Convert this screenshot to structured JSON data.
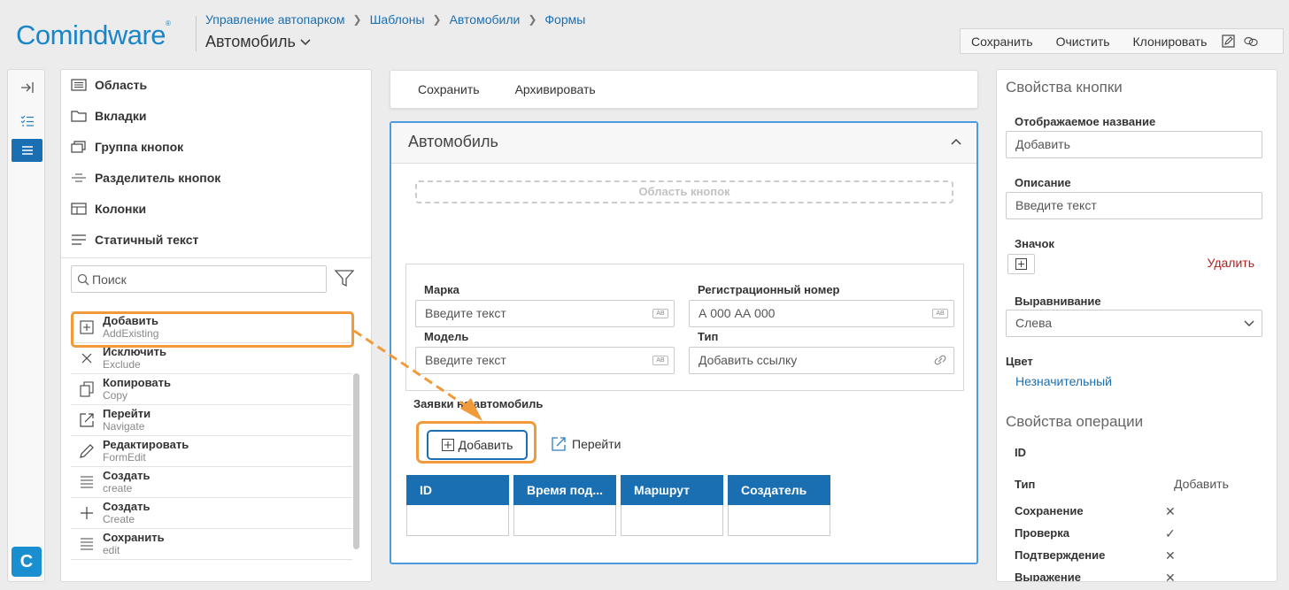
{
  "header": {
    "logo": "Comindware",
    "logo_mark": "®",
    "breadcrumbs": [
      "Управление автопарком",
      "Шаблоны",
      "Автомобили",
      "Формы"
    ],
    "page_title": "Автомобиль",
    "toolbar": {
      "save": "Сохранить",
      "clear": "Очистить",
      "clone": "Клонировать"
    }
  },
  "rail": {
    "brand_letter": "C"
  },
  "left_panel": {
    "sections": [
      "Область",
      "Вкладки",
      "Группа кнопок",
      "Разделитель кнопок",
      "Колонки",
      "Статичный текст"
    ],
    "search_placeholder": "Поиск",
    "operations": [
      {
        "name": "Добавить",
        "code": "AddExisting",
        "icon": "plus-square-icon"
      },
      {
        "name": "Исключить",
        "code": "Exclude",
        "icon": "close-icon"
      },
      {
        "name": "Копировать",
        "code": "Copy",
        "icon": "copy-icon"
      },
      {
        "name": "Перейти",
        "code": "Navigate",
        "icon": "external-link-icon"
      },
      {
        "name": "Редактировать",
        "code": "FormEdit",
        "icon": "pencil-icon"
      },
      {
        "name": "Создать",
        "code": "create",
        "icon": "list-icon"
      },
      {
        "name": "Создать",
        "code": "Create",
        "icon": "plus-icon"
      },
      {
        "name": "Сохранить",
        "code": "edit",
        "icon": "list-icon"
      }
    ]
  },
  "form": {
    "actions": [
      "Сохранить",
      "Архивировать"
    ],
    "title": "Автомобиль",
    "button_area": "Область кнопок",
    "fields": {
      "brand_label": "Марка",
      "brand_placeholder": "Введите текст",
      "reg_label": "Регистрационный номер",
      "reg_placeholder": "А 000 АА 000",
      "model_label": "Модель",
      "model_placeholder": "Введите текст",
      "type_label": "Тип",
      "type_placeholder": "Добавить ссылку"
    },
    "subtable_label": "Заявки на автомобиль",
    "add_button": "Добавить",
    "go_button": "Перейти",
    "columns": [
      "ID",
      "Время под...",
      "Маршрут",
      "Создатель"
    ]
  },
  "right_panel": {
    "button_props_title": "Свойства кнопки",
    "display_name_label": "Отображаемое название",
    "display_name_value": "Добавить",
    "description_label": "Описание",
    "description_placeholder": "Введите текст",
    "icon_label": "Значок",
    "delete_label": "Удалить",
    "align_label": "Выравнивание",
    "align_value": "Слева",
    "color_label": "Цвет",
    "color_value": "Незначительный",
    "op_props_title": "Свойства операции",
    "id_label": "ID",
    "type_label": "Тип",
    "type_value": "Добавить",
    "save_label": "Сохранение",
    "save_flag": "✕",
    "check_label": "Проверка",
    "check_flag": "✓",
    "confirm_label": "Подтверждение",
    "confirm_flag": "✕",
    "expr_label": "Выражение",
    "expr_flag": "✕"
  },
  "colors": {
    "accent": "#1a6fb3",
    "highlight": "#f09a3a",
    "brand": "#1a86c7"
  }
}
